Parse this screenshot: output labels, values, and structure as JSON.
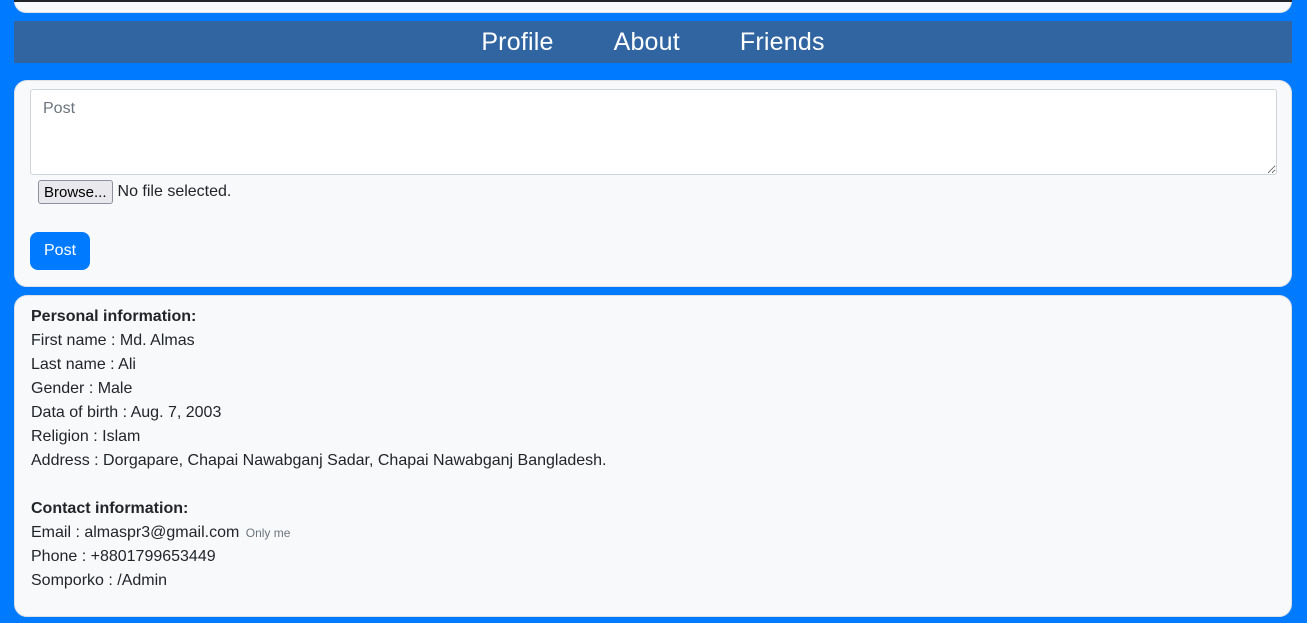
{
  "nav": {
    "profile": "Profile",
    "about": "About",
    "friends": "Friends"
  },
  "post": {
    "placeholder": "Post",
    "browse_label": "Browse...",
    "file_status": "No file selected.",
    "submit_label": "Post"
  },
  "personal": {
    "heading": "Personal information:",
    "first_name": "First name : Md. Almas",
    "last_name": "Last name : Ali",
    "gender": "Gender : Male",
    "dob": "Data of birth : Aug. 7, 2003",
    "religion": "Religion : Islam",
    "address": "Address : Dorgapare, Chapai Nawabganj Sadar, Chapai Nawabganj Bangladesh."
  },
  "contact": {
    "heading": "Contact information:",
    "email": "Email : almaspr3@gmail.com",
    "email_privacy": "Only me",
    "phone": "Phone : +8801799653449",
    "somporko": "Somporko : /Admin"
  },
  "colors": {
    "page_background": "#007bff",
    "navbar": "#3065a2",
    "card": "#f8f9fa",
    "primary_button": "#007bff"
  }
}
